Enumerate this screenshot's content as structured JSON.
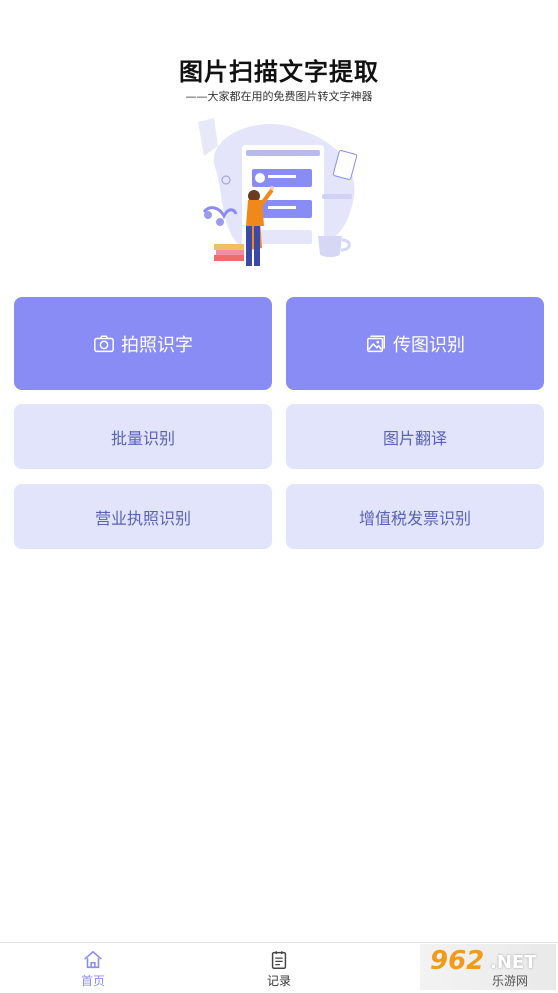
{
  "header": {
    "title": "图片扫描文字提取",
    "subtitle": "——大家都在用的免费图片转文字神器"
  },
  "actions": {
    "photo": {
      "label": "拍照识字",
      "icon": "camera-icon"
    },
    "upload": {
      "label": "传图识别",
      "icon": "image-icon"
    },
    "batch": {
      "label": "批量识别"
    },
    "translate": {
      "label": "图片翻译"
    },
    "license": {
      "label": "营业执照识别"
    },
    "invoice": {
      "label": "增值税发票识别"
    }
  },
  "tabbar": {
    "home": {
      "label": "首页",
      "icon": "home-icon"
    },
    "records": {
      "label": "记录",
      "icon": "notepad-icon"
    }
  },
  "watermark": {
    "text1": "962",
    "text2": ".NET",
    "text3": "乐游网"
  },
  "colors": {
    "primary": "#8a8cf5",
    "secondary": "#e1e4fb",
    "secondary_text": "#5a62b8"
  }
}
